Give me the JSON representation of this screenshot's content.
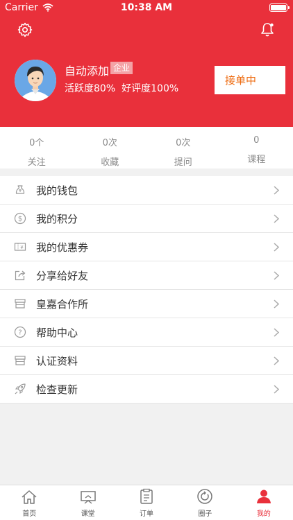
{
  "status_bar": {
    "carrier": "Carrier",
    "time": "10:38 AM"
  },
  "profile": {
    "name": "自动添加",
    "tag": "企业",
    "activity": "活跃度80%",
    "rating": "好评度100%",
    "order_button": "接单中"
  },
  "counts": [
    {
      "value": "0个",
      "label": "关注"
    },
    {
      "value": "0次",
      "label": "收藏"
    },
    {
      "value": "0次",
      "label": "提问"
    },
    {
      "value": "0",
      "label": "课程"
    }
  ],
  "menu": [
    {
      "label": "我的钱包",
      "icon": "wallet-icon"
    },
    {
      "label": "我的积分",
      "icon": "points-icon"
    },
    {
      "label": "我的优惠券",
      "icon": "coupon-icon"
    },
    {
      "label": "分享给好友",
      "icon": "share-icon"
    },
    {
      "label": "皇嘉合作所",
      "icon": "store-icon"
    },
    {
      "label": "帮助中心",
      "icon": "help-icon"
    },
    {
      "label": "认证资料",
      "icon": "certification-icon"
    },
    {
      "label": "检查更新",
      "icon": "rocket-icon"
    }
  ],
  "tabs": [
    {
      "label": "首页",
      "icon": "home-icon"
    },
    {
      "label": "课堂",
      "icon": "classroom-icon"
    },
    {
      "label": "订单",
      "icon": "order-icon"
    },
    {
      "label": "圈子",
      "icon": "circle-icon"
    },
    {
      "label": "我的",
      "icon": "profile-icon",
      "active": true
    }
  ],
  "colors": {
    "brand_red": "#e9303b",
    "order_text": "#ee6b10"
  }
}
